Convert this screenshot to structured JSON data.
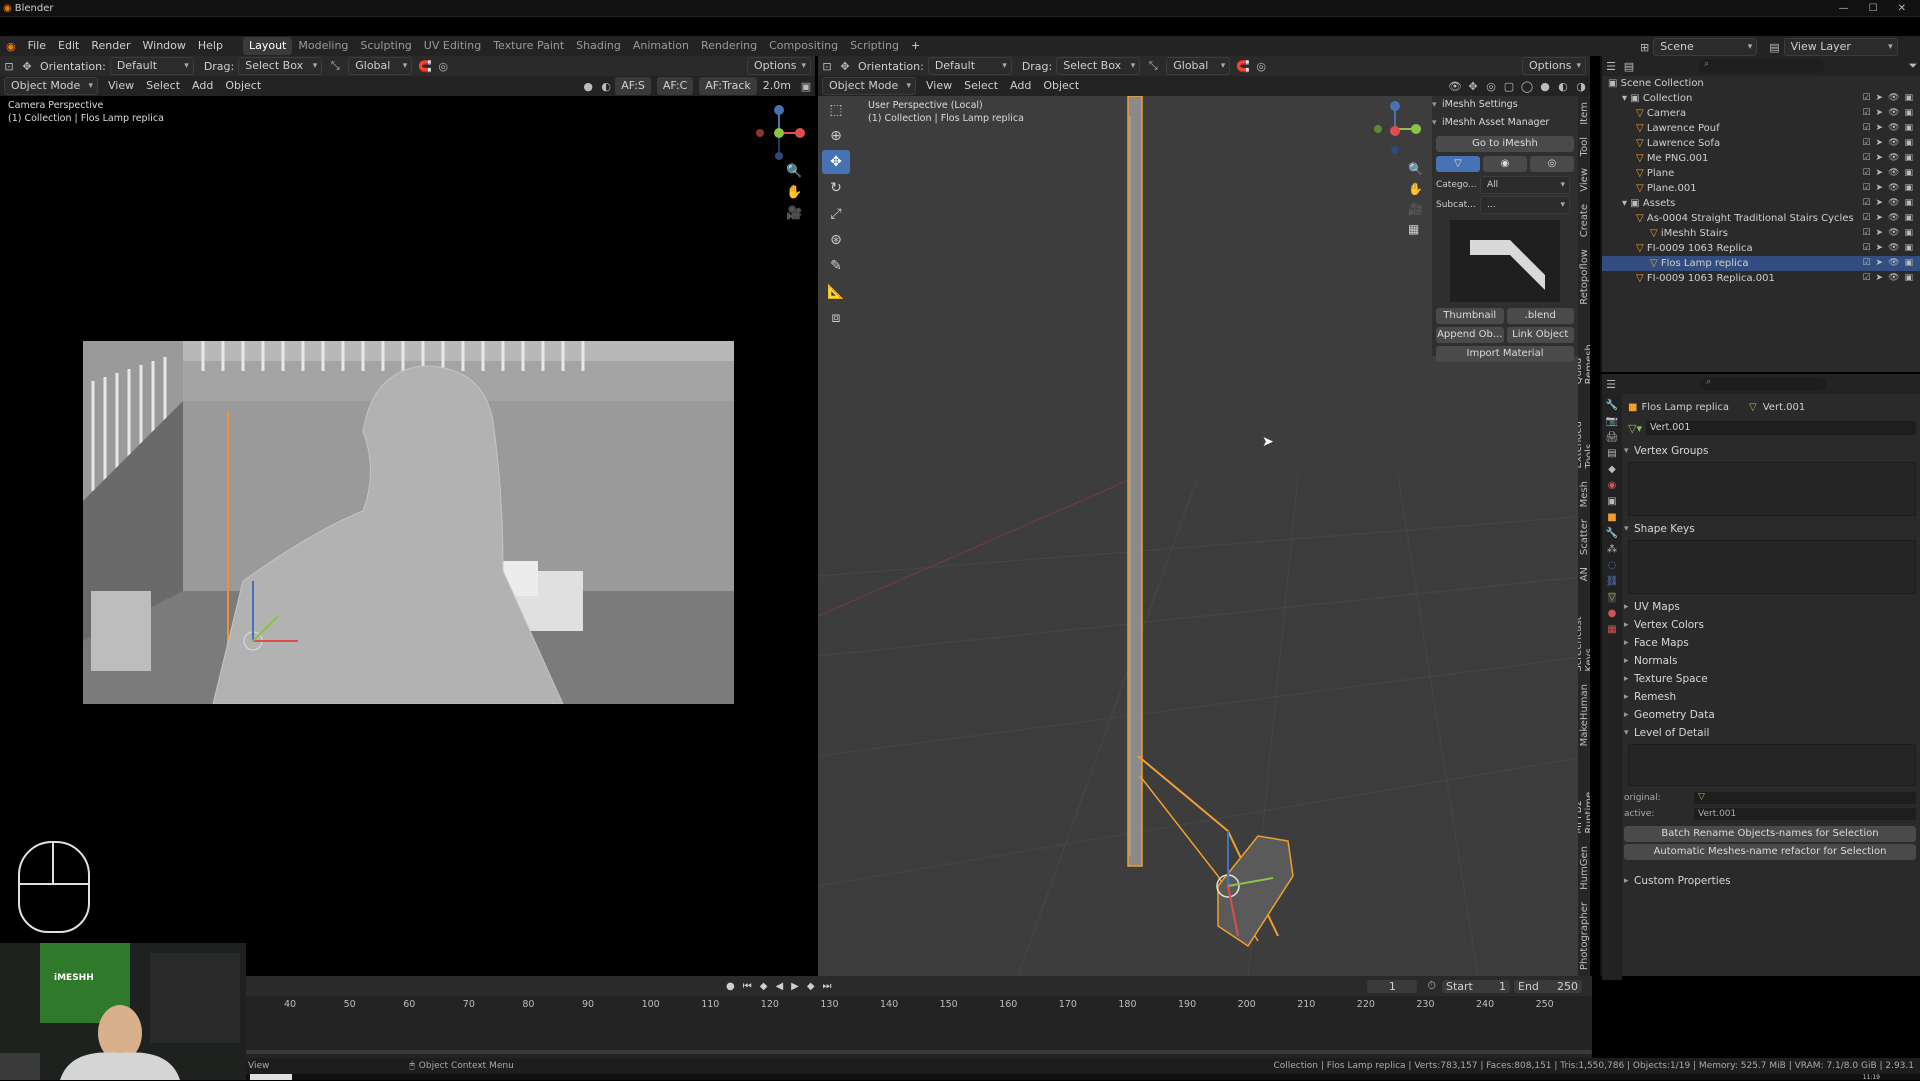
{
  "window": {
    "title": "Blender"
  },
  "menu": [
    "File",
    "Edit",
    "Render",
    "Window",
    "Help"
  ],
  "workspaces": [
    "Layout",
    "Modeling",
    "Sculpting",
    "UV Editing",
    "Texture Paint",
    "Shading",
    "Animation",
    "Rendering",
    "Compositing",
    "Scripting",
    "+"
  ],
  "scene_selector": {
    "scene": "Scene",
    "view_layer": "View Layer"
  },
  "toolbar_left": {
    "orientation_label": "Orientation:",
    "orientation_value": "Default",
    "drag_label": "Drag:",
    "drag_value": "Select Box",
    "pivot_value": "Global",
    "options": "Options"
  },
  "toolbar_right": {
    "orientation_label": "Orientation:",
    "orientation_value": "Default",
    "drag_label": "Drag:",
    "drag_value": "Select Box",
    "pivot_value": "Global",
    "options": "Options"
  },
  "viewport_left": {
    "mode": "Object Mode",
    "menus": [
      "View",
      "Select",
      "Add",
      "Object"
    ],
    "af_s": "AF:S",
    "af_c": "AF:C",
    "af_track": "AF:Track",
    "distance": "2.0m",
    "title": "Camera Perspective",
    "subtitle": "(1) Collection | Flos Lamp replica"
  },
  "viewport_right": {
    "mode": "Object Mode",
    "menus": [
      "View",
      "Select",
      "Add",
      "Object"
    ],
    "title": "User Perspective (Local)",
    "subtitle": "(1) Collection | Flos Lamp replica"
  },
  "imeshh": {
    "settings": "iMeshh Settings",
    "asset_manager": "iMeshh Asset Manager",
    "go_button": "Go to iMeshh",
    "category_label": "Catego...",
    "category_value": "All",
    "subcat_label": "Subcat...",
    "subcat_value": "...",
    "thumbnail": "Thumbnail",
    "blend": ".blend",
    "append": "Append Ob...",
    "link": "Link Object",
    "import_material": "Import Material"
  },
  "side_tabs": [
    "Item",
    "Tool",
    "View",
    "Create",
    "Retopoflow",
    "Quad Remesh",
    "Extended Tools",
    "Mesh",
    "Scatter",
    "AN",
    "Screencast Keys",
    "MakeHuman",
    "MPFB2 Runtime",
    "HumGen",
    "Photographer"
  ],
  "outliner": {
    "root": "Scene Collection",
    "rows": [
      {
        "label": "Collection",
        "depth": 1,
        "selected": false
      },
      {
        "label": "Camera",
        "depth": 2,
        "selected": false
      },
      {
        "label": "Lawrence Pouf",
        "depth": 2,
        "selected": false
      },
      {
        "label": "Lawrence Sofa",
        "depth": 2,
        "selected": false
      },
      {
        "label": "Me PNG.001",
        "depth": 2,
        "selected": false
      },
      {
        "label": "Plane",
        "depth": 2,
        "selected": false
      },
      {
        "label": "Plane.001",
        "depth": 2,
        "selected": false
      },
      {
        "label": "Assets",
        "depth": 1,
        "selected": false
      },
      {
        "label": "As-0004 Straight Traditional Stairs Cycles",
        "depth": 2,
        "selected": false
      },
      {
        "label": "iMeshh Stairs",
        "depth": 3,
        "selected": false
      },
      {
        "label": "FI-0009 1063 Replica",
        "depth": 2,
        "selected": false
      },
      {
        "label": "Flos Lamp replica",
        "depth": 3,
        "selected": true
      },
      {
        "label": "FI-0009 1063 Replica.001",
        "depth": 2,
        "selected": false
      }
    ]
  },
  "properties": {
    "object": "Flos Lamp replica",
    "mesh": "Vert.001",
    "mesh_field": "Vert.001",
    "sections": [
      {
        "label": "Vertex Groups",
        "open": true
      },
      {
        "label": "Shape Keys",
        "open": true
      },
      {
        "label": "UV Maps",
        "open": false
      },
      {
        "label": "Vertex Colors",
        "open": false
      },
      {
        "label": "Face Maps",
        "open": false
      },
      {
        "label": "Normals",
        "open": false
      },
      {
        "label": "Texture Space",
        "open": false
      },
      {
        "label": "Remesh",
        "open": false
      },
      {
        "label": "Geometry Data",
        "open": false
      },
      {
        "label": "Level of Detail",
        "open": true
      }
    ],
    "lod_original_label": "original:",
    "lod_active_label": "active:",
    "lod_active_value": "Vert.001",
    "batch_rename": "Batch Rename Objects-names for Selection",
    "auto_rename": "Automatic Meshes-name refactor for Selection",
    "custom_props": "Custom Properties"
  },
  "timeline": {
    "frame": "1",
    "start_label": "Start",
    "start": "1",
    "end_label": "End",
    "end": "250",
    "ticks": [
      "40",
      "50",
      "60",
      "70",
      "80",
      "90",
      "100",
      "110",
      "120",
      "130",
      "140",
      "150",
      "160",
      "170",
      "180",
      "190",
      "200",
      "210",
      "220",
      "230",
      "240",
      "250"
    ]
  },
  "status": {
    "left": "View",
    "context": "Object Context Menu",
    "right": "Collection | Flos Lamp replica | Verts:783,157 | Faces:808,151 | Tris:1,550,786 | Objects:1/19 | Memory: 525.7 MiB | VRAM: 7.1/8.0 GiB | 2.93.1",
    "clock": "11:19"
  },
  "webcam": {
    "logo": "iMESHH"
  },
  "colors": {
    "accent": "#4772b3",
    "selection": "#f0a030",
    "panel": "#303030",
    "viewport": "#3d3d3d"
  }
}
